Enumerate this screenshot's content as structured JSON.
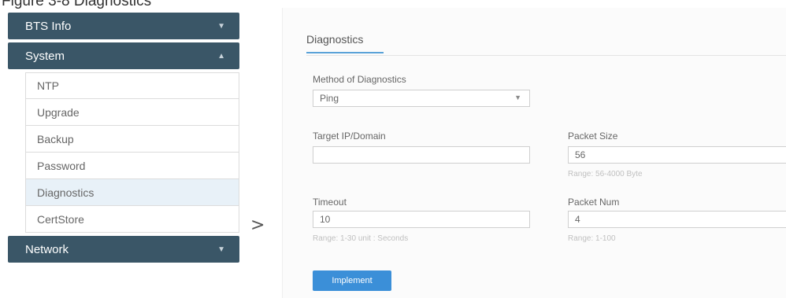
{
  "caption": "Figure 3-8 Diagnostics",
  "sidebar": {
    "sections": [
      {
        "label": "BTS Info"
      },
      {
        "label": "System"
      },
      {
        "label": "Network"
      }
    ],
    "system_items": [
      "NTP",
      "Upgrade",
      "Backup",
      "Password",
      "Diagnostics",
      "CertStore"
    ]
  },
  "content": {
    "tab": "Diagnostics",
    "method": {
      "label": "Method of Diagnostics",
      "value": "Ping"
    },
    "target": {
      "label": "Target IP/Domain",
      "value": ""
    },
    "packet_size": {
      "label": "Packet Size",
      "value": "56",
      "hint": "Range: 56-4000 Byte"
    },
    "timeout": {
      "label": "Timeout",
      "value": "10",
      "hint": "Range: 1-30 unit : Seconds"
    },
    "packet_num": {
      "label": "Packet Num",
      "value": "4",
      "hint": "Range: 1-100"
    },
    "implement_button": "Implement"
  }
}
